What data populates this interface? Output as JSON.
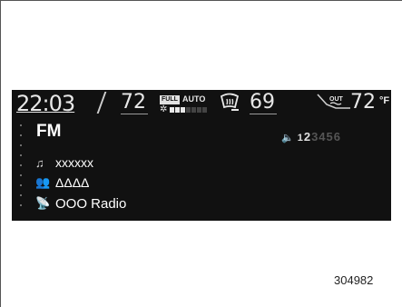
{
  "status": {
    "clock": "22:03",
    "driver_temp": "72",
    "fan_badge": "FULL",
    "fan_mode": "AUTO",
    "fan_level_active": 3,
    "fan_level_total": 7,
    "passenger_temp": "69",
    "outside_temp": "72",
    "outside_unit": "°F"
  },
  "audio": {
    "source": "FM",
    "presets": [
      "1",
      "2",
      "3",
      "4",
      "5",
      "6"
    ],
    "active_preset": "2",
    "song": "xxxxxx",
    "artist": "ΔΔΔΔ",
    "station": "OOO Radio"
  },
  "figure_number": "304982",
  "colors": {
    "screen_background": "#111111",
    "text": "#ffffff",
    "inactive_preset": "#555555"
  }
}
